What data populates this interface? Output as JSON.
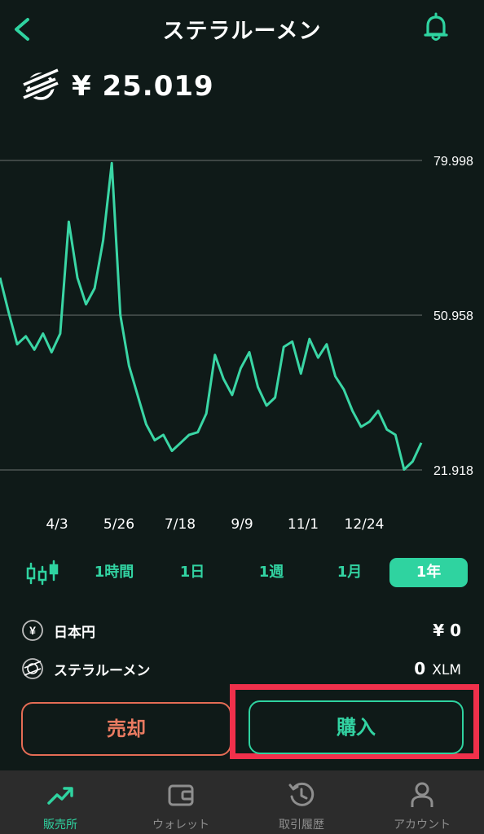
{
  "header": {
    "title": "ステラルーメン",
    "back_icon": "chevron-left-icon",
    "bell_icon": "bell-icon"
  },
  "price": {
    "logo_icon": "stellar-logo-icon",
    "value": "¥ 25.019"
  },
  "chart_data": {
    "type": "line",
    "y_ticks": [
      "79.998",
      "50.958",
      "21.918"
    ],
    "ylim": [
      21.918,
      79.998
    ],
    "x_ticks": [
      "4/3",
      "5/26",
      "7/18",
      "9/9",
      "11/1",
      "12/24"
    ],
    "color": "#3ad6a5",
    "x": [
      "3/1",
      "3/8",
      "3/15",
      "3/22",
      "3/29",
      "4/5",
      "4/12",
      "4/19",
      "4/26",
      "5/3",
      "5/10",
      "5/17",
      "5/24",
      "5/31",
      "6/7",
      "6/14",
      "6/21",
      "6/28",
      "7/5",
      "7/12",
      "7/19",
      "7/26",
      "8/2",
      "8/9",
      "8/16",
      "8/23",
      "8/30",
      "9/6",
      "9/13",
      "9/20",
      "9/27",
      "10/4",
      "10/11",
      "10/18",
      "10/25",
      "11/1",
      "11/8",
      "11/15",
      "11/22",
      "11/29",
      "12/6",
      "12/13",
      "12/20",
      "12/27",
      "1/3",
      "1/10",
      "1/17",
      "1/24",
      "1/31",
      "2/7"
    ],
    "values": [
      58.0,
      51.5,
      45.5,
      47.0,
      44.5,
      47.5,
      44.0,
      47.5,
      68.5,
      58.0,
      53.0,
      56.0,
      65.0,
      79.5,
      51.0,
      41.5,
      36.0,
      30.5,
      27.5,
      28.5,
      25.5,
      27.0,
      28.5,
      29.0,
      32.5,
      43.5,
      39.0,
      36.0,
      41.0,
      44.0,
      37.5,
      34.0,
      35.5,
      45.0,
      46.0,
      40.0,
      46.5,
      43.0,
      45.5,
      39.5,
      37.0,
      33.0,
      30.0,
      31.0,
      33.0,
      29.5,
      28.5,
      22.0,
      23.5,
      27.0
    ]
  },
  "periods": {
    "candle_icon": "candlestick-icon",
    "items": [
      "1時間",
      "1日",
      "1週",
      "1月",
      "1年"
    ],
    "active": "1年"
  },
  "assets": [
    {
      "icon": "yen-icon",
      "name": "日本円",
      "value": "¥ 0",
      "unit": ""
    },
    {
      "icon": "stellar-logo-icon",
      "name": "ステラルーメン",
      "value": "0",
      "unit": "XLM"
    }
  ],
  "actions": {
    "sell_label": "売却",
    "buy_label": "購入"
  },
  "tabbar": {
    "items": [
      {
        "label": "販売所",
        "icon": "trend-up-icon",
        "active": true
      },
      {
        "label": "ウォレット",
        "icon": "wallet-icon",
        "active": false
      },
      {
        "label": "取引履歴",
        "icon": "history-icon",
        "active": false
      },
      {
        "label": "アカウント",
        "icon": "person-icon",
        "active": false
      }
    ]
  }
}
